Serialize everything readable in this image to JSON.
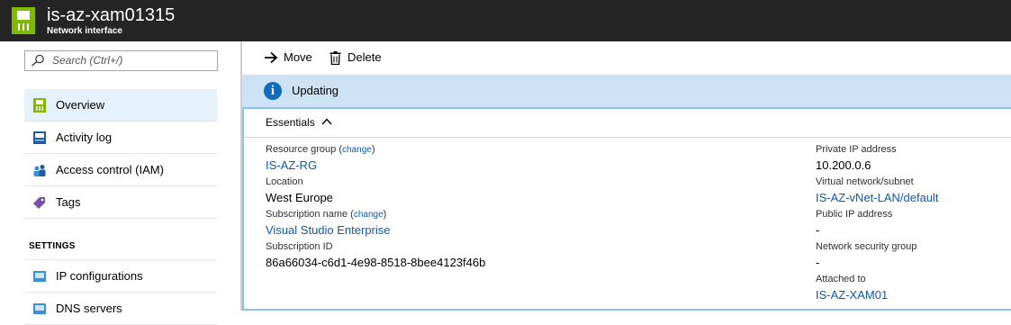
{
  "header": {
    "title": "is-az-xam01315",
    "subtitle": "Network interface",
    "icon": "network-interface-icon",
    "accent": "#7fba00"
  },
  "sidebar": {
    "search_placeholder": "Search (Ctrl+/)",
    "items": [
      {
        "label": "Overview",
        "icon": "overview-icon",
        "active": true
      },
      {
        "label": "Activity log",
        "icon": "activity-log-icon"
      },
      {
        "label": "Access control (IAM)",
        "icon": "people-icon"
      },
      {
        "label": "Tags",
        "icon": "tag-icon"
      }
    ],
    "section_settings": "SETTINGS",
    "settings_items": [
      {
        "label": "IP configurations",
        "icon": "ip-configurations-icon"
      },
      {
        "label": "DNS servers",
        "icon": "dns-servers-icon"
      }
    ]
  },
  "toolbar": {
    "move_label": "Move",
    "delete_label": "Delete"
  },
  "status": {
    "text": "Updating",
    "icon": "info-icon"
  },
  "essentials": {
    "header": "Essentials",
    "change_label": "change",
    "left": {
      "resource_group_label": "Resource group",
      "resource_group_value": "IS-AZ-RG",
      "location_label": "Location",
      "location_value": "West Europe",
      "subscription_name_label": "Subscription name",
      "subscription_name_value": "Visual Studio Enterprise",
      "subscription_id_label": "Subscription ID",
      "subscription_id_value": "86a66034-c6d1-4e98-8518-8bee4123f46b"
    },
    "right": {
      "private_ip_label": "Private IP address",
      "private_ip_value": "10.200.0.6",
      "vnet_label": "Virtual network/subnet",
      "vnet_value": "IS-AZ-vNet-LAN/default",
      "public_ip_label": "Public IP address",
      "public_ip_value": "-",
      "nsg_label": "Network security group",
      "nsg_value": "-",
      "attached_label": "Attached to",
      "attached_value": "IS-AZ-XAM01"
    }
  },
  "colors": {
    "link": "#0f5aa8",
    "banner": "#cde3f5",
    "titlebar": "#252526"
  }
}
